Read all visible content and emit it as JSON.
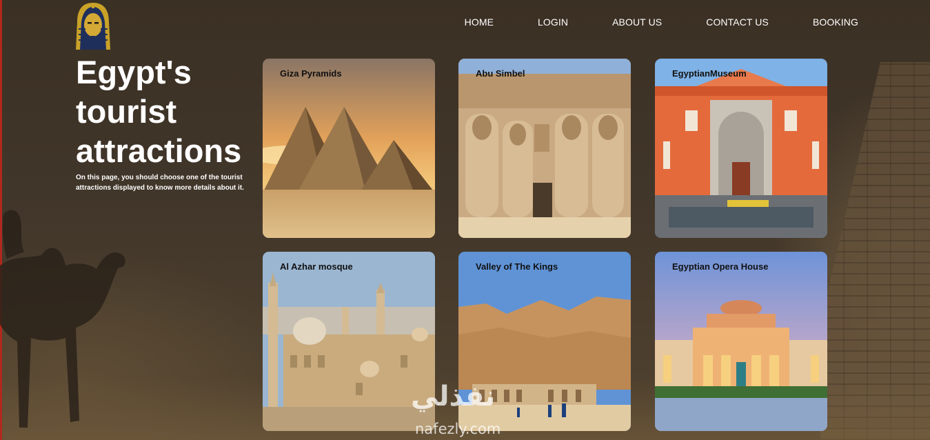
{
  "nav": {
    "items": [
      "HOME",
      "LOGIN",
      "ABOUT US",
      "CONTACT US",
      "BOOKING"
    ]
  },
  "hero": {
    "title": "Egypt's tourist attractions",
    "description": "On this page, you should choose one of the tourist attractions displayed to know more details about it."
  },
  "cards": [
    {
      "label": "Giza Pyramids"
    },
    {
      "label": "Abu Simbel"
    },
    {
      "label": "EgyptianMuseum"
    },
    {
      "label": "Al Azhar mosque"
    },
    {
      "label": "Valley of The Kings"
    },
    {
      "label": "Egyptian Opera House"
    }
  ],
  "watermark": {
    "arabic": "نفذلي",
    "latin": "nafezly.com"
  },
  "colors": {
    "background": "#3f3529",
    "text": "#ffffff",
    "card_label": "#111111",
    "accent_edge": "#b0281e"
  },
  "icons": {
    "logo": "tutankhamun-mask-logo"
  }
}
